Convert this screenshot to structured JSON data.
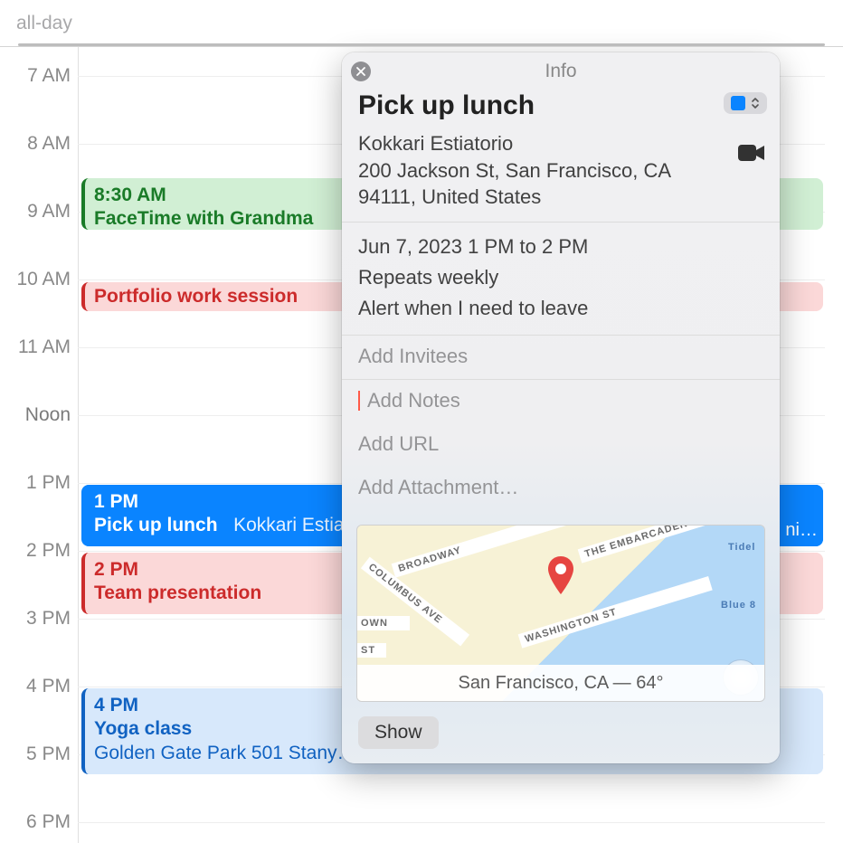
{
  "calendar": {
    "allday_label": "all-day",
    "hours": [
      {
        "label": "7 AM"
      },
      {
        "label": "8 AM"
      },
      {
        "label": "9 AM"
      },
      {
        "label": "10 AM"
      },
      {
        "label": "11 AM"
      },
      {
        "label": "Noon"
      },
      {
        "label": "1 PM"
      },
      {
        "label": "2 PM"
      },
      {
        "label": "3 PM"
      },
      {
        "label": "4 PM"
      },
      {
        "label": "5 PM"
      },
      {
        "label": "6 PM"
      }
    ],
    "events": {
      "facetime": {
        "time": "8:30 AM",
        "title": "FaceTime with Grandma"
      },
      "portfolio": {
        "title": "Portfolio work session"
      },
      "lunch": {
        "time": "1 PM",
        "title": "Pick up lunch",
        "loc": "Kokkari Estia…"
      },
      "team": {
        "time": "2 PM",
        "title": "Team presentation"
      },
      "yoga": {
        "time": "4 PM",
        "title": "Yoga class",
        "loc": "Golden Gate Park 501 Stany…"
      },
      "right_clip": "ni…"
    }
  },
  "popover": {
    "header": "Info",
    "title": "Pick up lunch",
    "location_name": "Kokkari Estiatorio",
    "address": "200 Jackson St, San Francisco, CA 94111, United States",
    "datetime": "Jun 7, 2023  1 PM to 2 PM",
    "repeat": "Repeats weekly",
    "alert": "Alert when I need to leave",
    "invitees_ph": "Add Invitees",
    "notes_ph": "Add Notes",
    "url_ph": "Add URL",
    "attach_ph": "Add Attachment…",
    "map": {
      "streets": {
        "broadway": "BROADWAY",
        "columbus": "COLUMBUS AVE",
        "embarcadero": "THE EMBARCADERO",
        "washington": "WASHINGTON ST",
        "own": "OWN",
        "st": "ST",
        "blue8": "Blue 8",
        "tidel": "Tidel"
      },
      "footer": "San Francisco, CA — 64°"
    },
    "show_btn": "Show"
  }
}
